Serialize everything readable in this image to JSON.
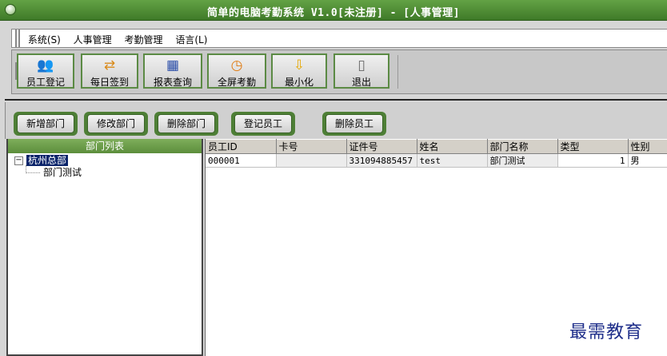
{
  "window": {
    "title": "简单的电脑考勤系统 V1.0[未注册] - [人事管理]"
  },
  "menu": [
    {
      "label": "系统(S)"
    },
    {
      "label": "人事管理"
    },
    {
      "label": "考勤管理"
    },
    {
      "label": "语言(L)"
    }
  ],
  "toolbar": {
    "buttons": [
      {
        "label": "员工登记",
        "icon": "people-icon"
      },
      {
        "label": "每日签到",
        "icon": "signin-icon"
      },
      {
        "label": "报表查询",
        "icon": "report-icon"
      },
      {
        "label": "全屏考勤",
        "icon": "clock-icon"
      },
      {
        "label": "最小化",
        "icon": "minimize-arrow-icon"
      },
      {
        "label": "退出",
        "icon": "exit-door-icon"
      }
    ]
  },
  "actions": {
    "add_dept": "新增部门",
    "edit_dept": "修改部门",
    "delete_dept": "删除部门",
    "register_employee": "登记员工",
    "delete_employee": "删除员工"
  },
  "dept_panel": {
    "header": "部门列表",
    "root": "杭州总部",
    "children": [
      "部门测试"
    ],
    "expander": "−"
  },
  "grid": {
    "columns": [
      "员工ID",
      "卡号",
      "证件号",
      "姓名",
      "部门名称",
      "类型",
      "性别"
    ],
    "rows": [
      [
        "000001",
        "",
        "331094885457",
        "test",
        "部门测试",
        "1",
        "男"
      ]
    ]
  },
  "watermark": "最需教育",
  "colors": {
    "title_bar": "#4f8d34",
    "panel_header": "#6e9e4b",
    "selection": "#0a246a",
    "watermark": "#1e2e8a"
  }
}
